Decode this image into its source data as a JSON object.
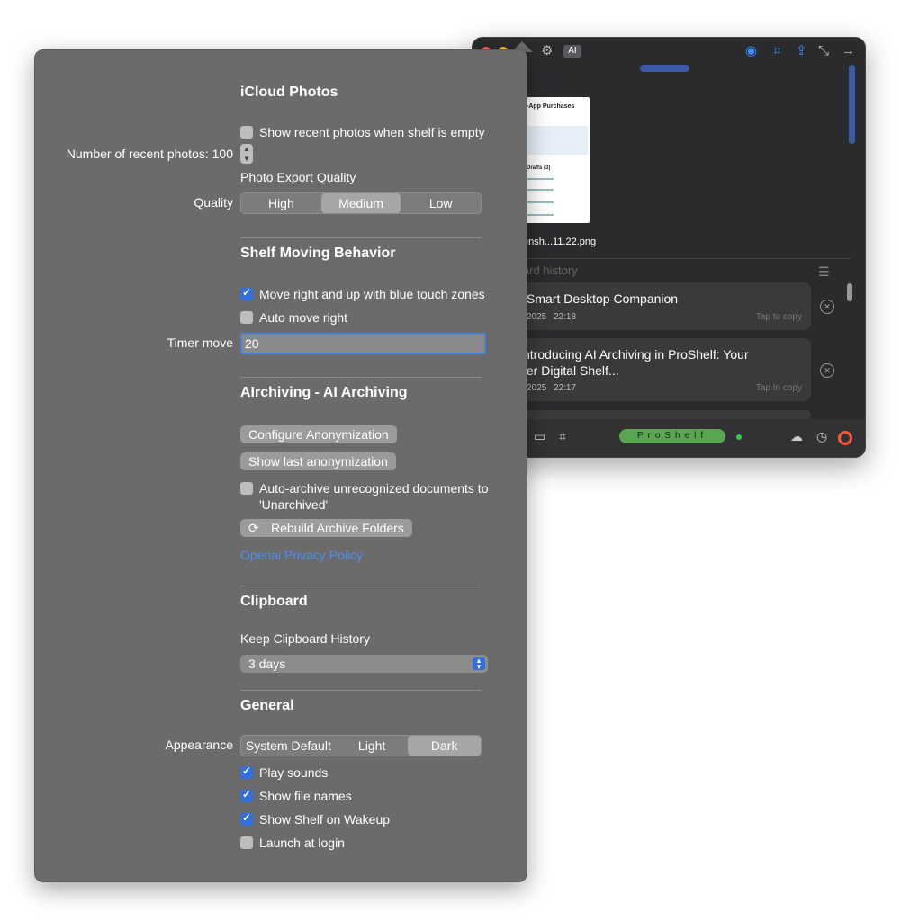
{
  "shelf_window": {
    "ai_badge": "AI",
    "screenshot_name": "ensh...11.22.png",
    "thumb_title": "-App Purchases",
    "thumb_drafts": "Drafts (3)",
    "history_title": "ard history",
    "cards": [
      {
        "title": "Smart Desktop Companion",
        "date": "2025",
        "time": "22:18",
        "tap": "Tap to copy"
      },
      {
        "title_line1": "ntroducing AI Archiving in ProShelf: Your",
        "title_line2": "ter Digital Shelf...",
        "date": "2025",
        "time": "22:17",
        "tap": "Tap to copy"
      }
    ],
    "brand": "ProShelf",
    "colors": {
      "accent": "#3d8bfd",
      "brand_green": "#5aa552",
      "status_dot": "#33cc44"
    }
  },
  "prefs": {
    "icloud": {
      "title": "iCloud Photos",
      "show_recent_label": "Show recent photos when shelf is empty",
      "show_recent_checked": false,
      "recent_count_label": "Number of recent photos: 100",
      "export_quality_label": "Photo Export Quality",
      "quality_label": "Quality",
      "quality_options": [
        "High",
        "Medium",
        "Low"
      ],
      "quality_selected": "Medium"
    },
    "moving": {
      "title": "Shelf Moving Behavior",
      "move_right_up_label": "Move right and up with blue touch zones",
      "move_right_up_checked": true,
      "auto_move_label": "Auto move right",
      "auto_move_checked": false,
      "timer_label": "Timer move",
      "timer_value": "20"
    },
    "archiving": {
      "title": "AIrchiving - AI Archiving",
      "configure_button": "Configure Anonymization",
      "show_last_button": "Show last anonymization",
      "auto_archive_line1": "Auto-archive unrecognized documents to",
      "auto_archive_line2": "'Unarchived'",
      "auto_archive_checked": false,
      "rebuild_button": "Rebuild Archive Folders",
      "privacy_link": "Openai Privacy Policy"
    },
    "clipboard": {
      "title": "Clipboard",
      "keep_label": "Keep Clipboard History",
      "keep_value": "3 days"
    },
    "general": {
      "title": "General",
      "appearance_label": "Appearance",
      "appearance_options": [
        "System Default",
        "Light",
        "Dark"
      ],
      "appearance_selected": "Dark",
      "play_sounds": "Play sounds",
      "show_file_names": "Show file names",
      "show_on_wakeup": "Show Shelf on Wakeup",
      "launch_at_login": "Launch at login"
    }
  }
}
